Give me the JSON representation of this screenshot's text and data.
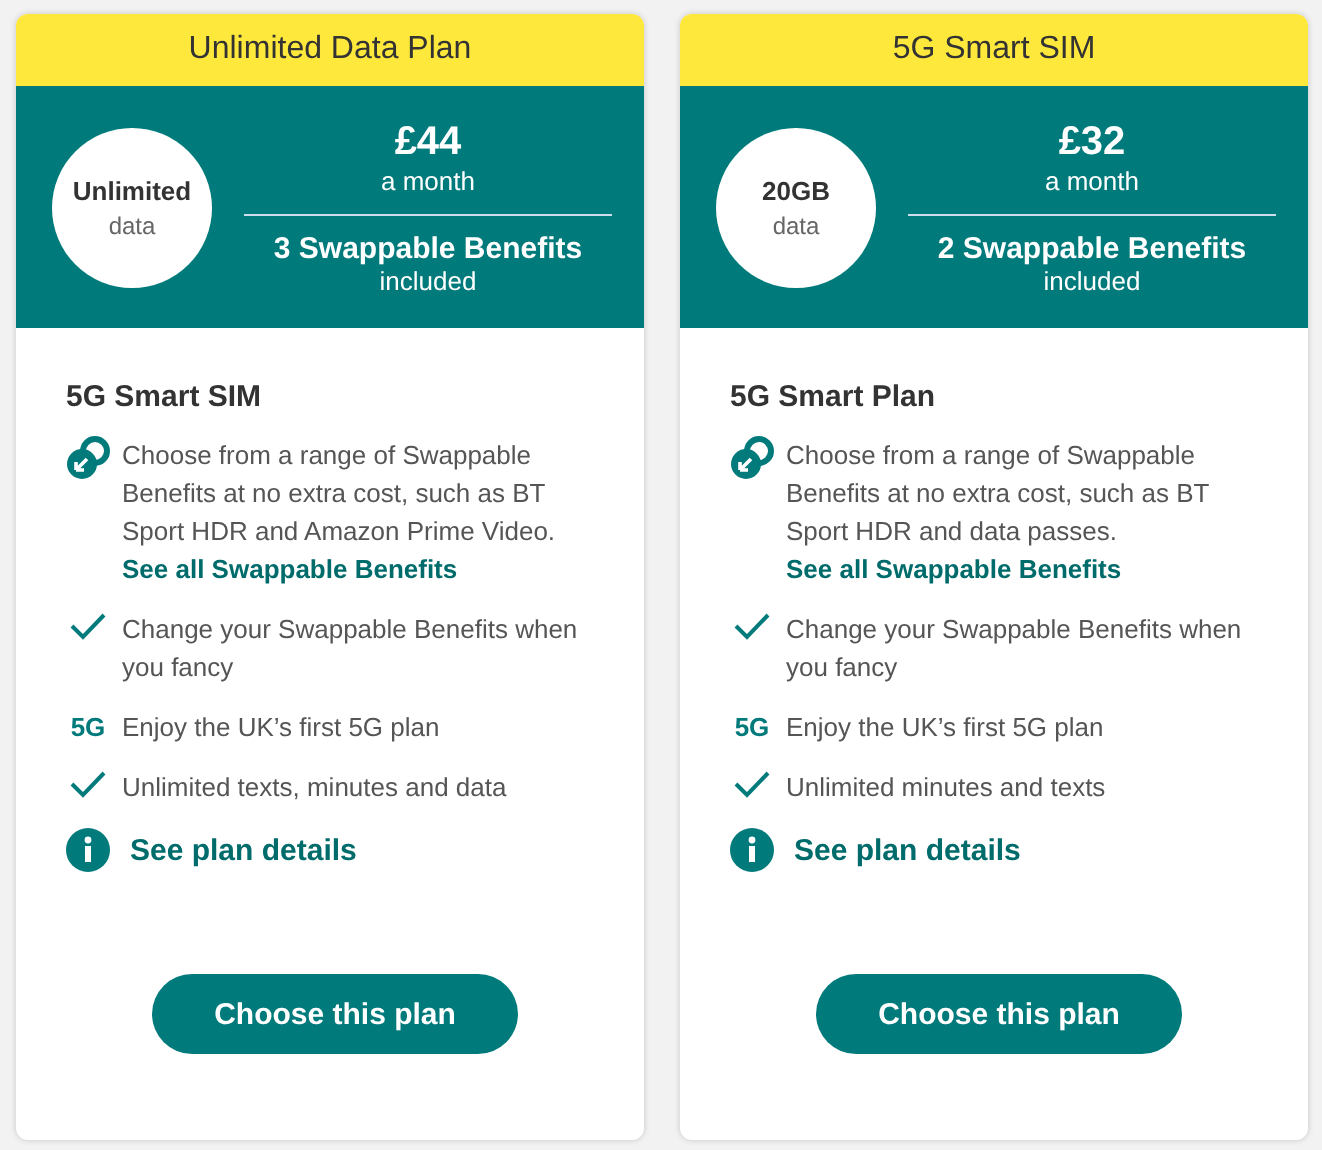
{
  "plans": [
    {
      "title": "Unlimited Data Plan",
      "allowance": "Unlimited",
      "allowance_unit": "data",
      "price": "£44",
      "price_unit": "a month",
      "benefits": "3 Swappable Benefits",
      "benefits_unit": "included",
      "heading": "5G Smart SIM",
      "features": [
        {
          "kind": "swap",
          "text": "Choose from a range of Swappable Benefits at no extra cost, such as BT Sport HDR and Amazon Prime Video. ",
          "link": "See all Swappable Benefits"
        },
        {
          "kind": "check",
          "text": "Change your Swappable Benefits when you fancy"
        },
        {
          "kind": "badge",
          "badge": "5G",
          "text": "Enjoy the UK’s first 5G plan"
        },
        {
          "kind": "check",
          "text": "Unlimited texts, minutes and data"
        }
      ],
      "details": "See plan details",
      "button": "Choose this plan"
    },
    {
      "title": "5G Smart SIM",
      "allowance": "20GB",
      "allowance_unit": "data",
      "price": "£32",
      "price_unit": "a month",
      "benefits": "2 Swappable Benefits",
      "benefits_unit": "included",
      "heading": "5G Smart Plan",
      "features": [
        {
          "kind": "swap",
          "text": "Choose from a range of Swappable Benefits at no extra cost, such as BT Sport HDR and data passes. ",
          "link": "See all Swappable Benefits"
        },
        {
          "kind": "check",
          "text": "Change your Swappable Benefits when you fancy"
        },
        {
          "kind": "badge",
          "badge": "5G",
          "text": "Enjoy the UK’s first 5G plan"
        },
        {
          "kind": "check",
          "text": "Unlimited minutes and texts"
        }
      ],
      "details": "See plan details",
      "button": "Choose this plan"
    }
  ]
}
